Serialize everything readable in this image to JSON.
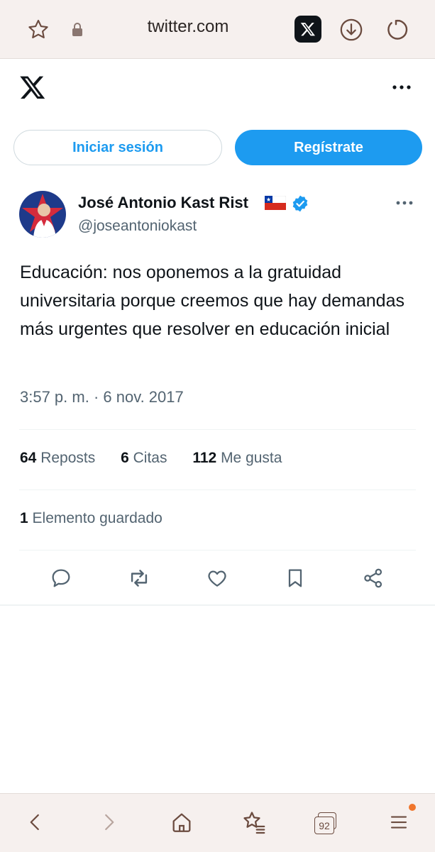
{
  "browser": {
    "url": "twitter.com",
    "tab_count": "92",
    "icons": [
      "star-icon",
      "lock-icon",
      "x-app-icon",
      "download-icon",
      "reload-icon"
    ],
    "nav_icons": [
      "back-icon",
      "forward-icon",
      "home-icon",
      "bookmarks-icon",
      "tabs-icon",
      "menu-icon"
    ],
    "colors": {
      "bar_bg": "#f6f0ee",
      "icon": "#6b4b3f",
      "notification_dot": "#f0762d"
    }
  },
  "header": {
    "logo": "x-logo"
  },
  "auth": {
    "login_label": "Iniciar sesión",
    "signup_label": "Regístrate"
  },
  "tweet": {
    "author_name": "José Antonio Kast Rist",
    "handle": "@joseantoniokast",
    "text": "Educación: nos oponemos a la gratuidad universitaria porque creemos que hay demandas más urgentes que resolver en educación inicial",
    "timestamp": "3:57 p. m. · 6 nov. 2017",
    "stats": {
      "reposts_count": "64",
      "reposts_label": "Reposts",
      "quotes_count": "6",
      "quotes_label": "Citas",
      "likes_count": "112",
      "likes_label": "Me gusta",
      "bookmarks_count": "1",
      "bookmarks_label": "Elemento guardado"
    }
  },
  "colors": {
    "accent": "#1d9bf0",
    "text_primary": "#0f1419",
    "text_secondary": "#536471",
    "divider": "#eff3f4"
  }
}
